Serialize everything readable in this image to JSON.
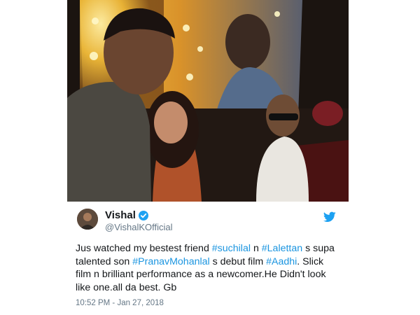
{
  "tweet": {
    "author_name": "Vishal",
    "author_handle": "@VishalKOfficial",
    "verified": true,
    "text_parts": [
      {
        "text": "Jus watched my bestest friend ",
        "type": "plain"
      },
      {
        "text": "#suchilal",
        "type": "hashtag"
      },
      {
        "text": " n ",
        "type": "plain"
      },
      {
        "text": "#Lalettan",
        "type": "hashtag"
      },
      {
        "text": " s supa talented son ",
        "type": "plain"
      },
      {
        "text": "#PranavMohanlal",
        "type": "hashtag"
      },
      {
        "text": " s debut film ",
        "type": "plain"
      },
      {
        "text": "#Aadhi",
        "type": "hashtag"
      },
      {
        "text": ". Slick film n brilliant performance as a newcomer.He Didn't look like one.all da best. Gb",
        "type": "plain"
      }
    ],
    "timestamp": "10:52 PM - Jan 27, 2018"
  },
  "colors": {
    "hashtag": "#1b95e0",
    "verified_badge": "#1da1f2",
    "twitter_bird": "#1da1f2",
    "text": "#14171a",
    "secondary_text": "#657786"
  },
  "icons": {
    "verified": "verified-badge-icon",
    "bird": "twitter-bird-icon"
  }
}
